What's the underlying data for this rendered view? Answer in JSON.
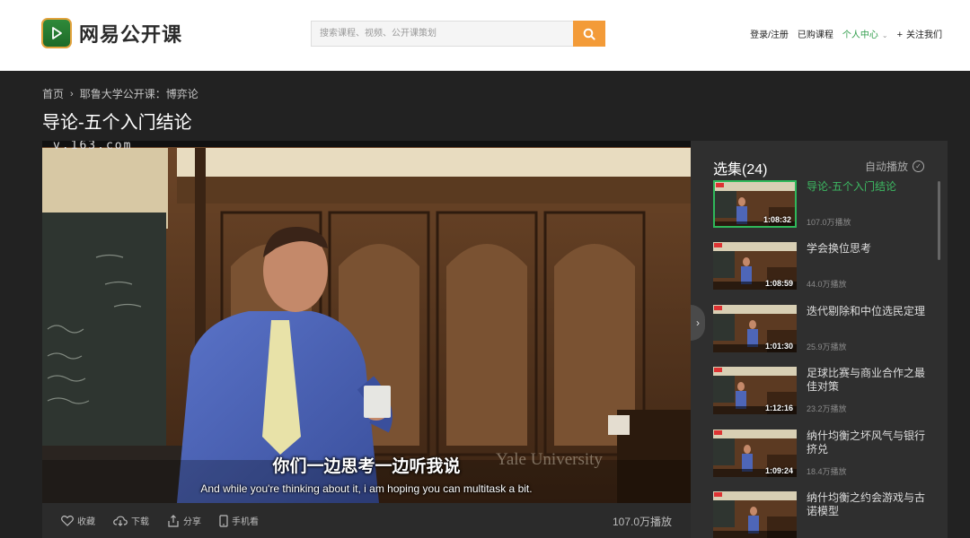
{
  "header": {
    "logo_text": "网易公开课",
    "search_placeholder": "搜索课程、视频、公开课策划",
    "nav": {
      "login": "登录/注册",
      "purchased": "已购课程",
      "personal_center": "个人中心",
      "follow": "关注我们"
    }
  },
  "breadcrumb": {
    "home": "首页",
    "course": "耶鲁大学公开课：博弈论"
  },
  "page_title": "导论-五个入门结论",
  "video": {
    "watermark": "v.163.com",
    "subtitle_cn": "你们一边思考一边听我说",
    "subtitle_en": "And while you're thinking about it, i am hoping you can multitask a bit.",
    "institution": "Yale University"
  },
  "video_toolbar": {
    "favorite": "收藏",
    "download": "下载",
    "share": "分享",
    "mobile": "手机看",
    "plays": "107.0万播放"
  },
  "episodes": {
    "header": "选集(24)",
    "autoplay": "自动播放",
    "items": [
      {
        "title": "导论-五个入门结论",
        "duration": "1:08:32",
        "plays": "107.0万播放",
        "selected": true
      },
      {
        "title": "学会换位思考",
        "duration": "1:08:59",
        "plays": "44.0万播放",
        "selected": false
      },
      {
        "title": "迭代剔除和中位选民定理",
        "duration": "1:01:30",
        "plays": "25.9万播放",
        "selected": false
      },
      {
        "title": "足球比赛与商业合作之最佳对策",
        "duration": "1:12:16",
        "plays": "23.2万播放",
        "selected": false
      },
      {
        "title": "纳什均衡之坏风气与银行挤兑",
        "duration": "1:09:24",
        "plays": "18.4万播放",
        "selected": false
      },
      {
        "title": "纳什均衡之约会游戏与古诺模型",
        "duration": "",
        "plays": "",
        "selected": false
      }
    ]
  },
  "colors": {
    "accent_green": "#2d9c49",
    "search_orange": "#f39b38",
    "page_bg": "#222222"
  }
}
